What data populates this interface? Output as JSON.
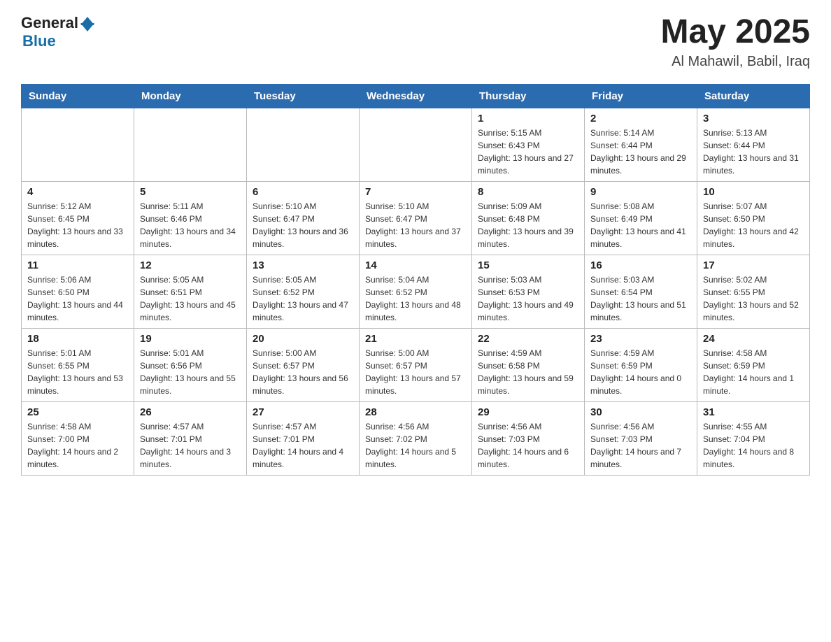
{
  "header": {
    "logo_general": "General",
    "logo_blue": "Blue",
    "title": "May 2025",
    "subtitle": "Al Mahawil, Babil, Iraq"
  },
  "days_of_week": [
    "Sunday",
    "Monday",
    "Tuesday",
    "Wednesday",
    "Thursday",
    "Friday",
    "Saturday"
  ],
  "weeks": [
    [
      {
        "day": "",
        "info": ""
      },
      {
        "day": "",
        "info": ""
      },
      {
        "day": "",
        "info": ""
      },
      {
        "day": "",
        "info": ""
      },
      {
        "day": "1",
        "info": "Sunrise: 5:15 AM\nSunset: 6:43 PM\nDaylight: 13 hours and 27 minutes."
      },
      {
        "day": "2",
        "info": "Sunrise: 5:14 AM\nSunset: 6:44 PM\nDaylight: 13 hours and 29 minutes."
      },
      {
        "day": "3",
        "info": "Sunrise: 5:13 AM\nSunset: 6:44 PM\nDaylight: 13 hours and 31 minutes."
      }
    ],
    [
      {
        "day": "4",
        "info": "Sunrise: 5:12 AM\nSunset: 6:45 PM\nDaylight: 13 hours and 33 minutes."
      },
      {
        "day": "5",
        "info": "Sunrise: 5:11 AM\nSunset: 6:46 PM\nDaylight: 13 hours and 34 minutes."
      },
      {
        "day": "6",
        "info": "Sunrise: 5:10 AM\nSunset: 6:47 PM\nDaylight: 13 hours and 36 minutes."
      },
      {
        "day": "7",
        "info": "Sunrise: 5:10 AM\nSunset: 6:47 PM\nDaylight: 13 hours and 37 minutes."
      },
      {
        "day": "8",
        "info": "Sunrise: 5:09 AM\nSunset: 6:48 PM\nDaylight: 13 hours and 39 minutes."
      },
      {
        "day": "9",
        "info": "Sunrise: 5:08 AM\nSunset: 6:49 PM\nDaylight: 13 hours and 41 minutes."
      },
      {
        "day": "10",
        "info": "Sunrise: 5:07 AM\nSunset: 6:50 PM\nDaylight: 13 hours and 42 minutes."
      }
    ],
    [
      {
        "day": "11",
        "info": "Sunrise: 5:06 AM\nSunset: 6:50 PM\nDaylight: 13 hours and 44 minutes."
      },
      {
        "day": "12",
        "info": "Sunrise: 5:05 AM\nSunset: 6:51 PM\nDaylight: 13 hours and 45 minutes."
      },
      {
        "day": "13",
        "info": "Sunrise: 5:05 AM\nSunset: 6:52 PM\nDaylight: 13 hours and 47 minutes."
      },
      {
        "day": "14",
        "info": "Sunrise: 5:04 AM\nSunset: 6:52 PM\nDaylight: 13 hours and 48 minutes."
      },
      {
        "day": "15",
        "info": "Sunrise: 5:03 AM\nSunset: 6:53 PM\nDaylight: 13 hours and 49 minutes."
      },
      {
        "day": "16",
        "info": "Sunrise: 5:03 AM\nSunset: 6:54 PM\nDaylight: 13 hours and 51 minutes."
      },
      {
        "day": "17",
        "info": "Sunrise: 5:02 AM\nSunset: 6:55 PM\nDaylight: 13 hours and 52 minutes."
      }
    ],
    [
      {
        "day": "18",
        "info": "Sunrise: 5:01 AM\nSunset: 6:55 PM\nDaylight: 13 hours and 53 minutes."
      },
      {
        "day": "19",
        "info": "Sunrise: 5:01 AM\nSunset: 6:56 PM\nDaylight: 13 hours and 55 minutes."
      },
      {
        "day": "20",
        "info": "Sunrise: 5:00 AM\nSunset: 6:57 PM\nDaylight: 13 hours and 56 minutes."
      },
      {
        "day": "21",
        "info": "Sunrise: 5:00 AM\nSunset: 6:57 PM\nDaylight: 13 hours and 57 minutes."
      },
      {
        "day": "22",
        "info": "Sunrise: 4:59 AM\nSunset: 6:58 PM\nDaylight: 13 hours and 59 minutes."
      },
      {
        "day": "23",
        "info": "Sunrise: 4:59 AM\nSunset: 6:59 PM\nDaylight: 14 hours and 0 minutes."
      },
      {
        "day": "24",
        "info": "Sunrise: 4:58 AM\nSunset: 6:59 PM\nDaylight: 14 hours and 1 minute."
      }
    ],
    [
      {
        "day": "25",
        "info": "Sunrise: 4:58 AM\nSunset: 7:00 PM\nDaylight: 14 hours and 2 minutes."
      },
      {
        "day": "26",
        "info": "Sunrise: 4:57 AM\nSunset: 7:01 PM\nDaylight: 14 hours and 3 minutes."
      },
      {
        "day": "27",
        "info": "Sunrise: 4:57 AM\nSunset: 7:01 PM\nDaylight: 14 hours and 4 minutes."
      },
      {
        "day": "28",
        "info": "Sunrise: 4:56 AM\nSunset: 7:02 PM\nDaylight: 14 hours and 5 minutes."
      },
      {
        "day": "29",
        "info": "Sunrise: 4:56 AM\nSunset: 7:03 PM\nDaylight: 14 hours and 6 minutes."
      },
      {
        "day": "30",
        "info": "Sunrise: 4:56 AM\nSunset: 7:03 PM\nDaylight: 14 hours and 7 minutes."
      },
      {
        "day": "31",
        "info": "Sunrise: 4:55 AM\nSunset: 7:04 PM\nDaylight: 14 hours and 8 minutes."
      }
    ]
  ]
}
